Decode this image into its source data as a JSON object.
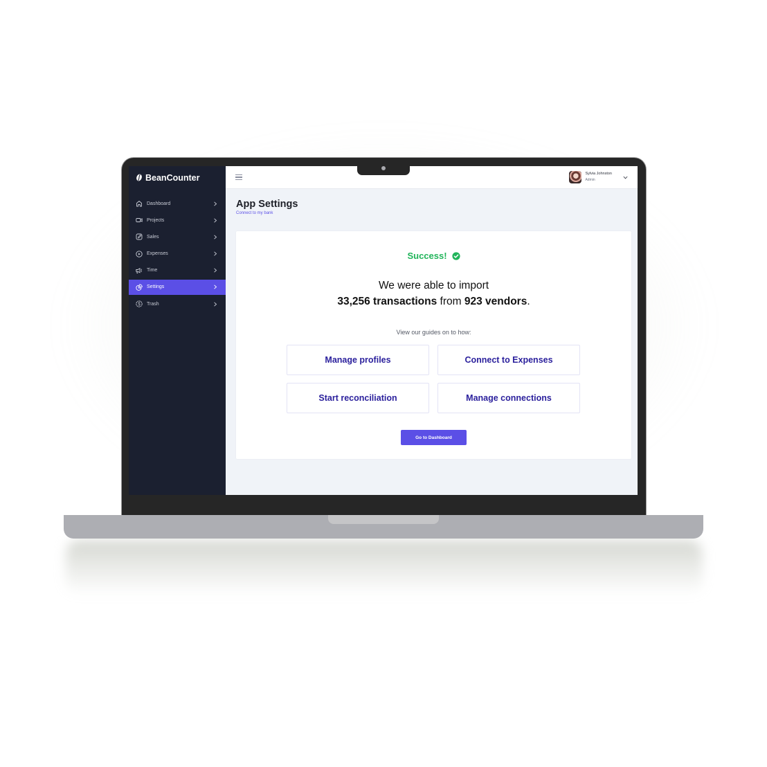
{
  "app": {
    "brand_name": "BeanCounter",
    "accent_color": "#5b4fe6",
    "sidebar_color": "#1b2030",
    "success_color": "#21b45a"
  },
  "sidebar": {
    "items": [
      {
        "label": "Dashboard",
        "icon": "home-icon",
        "active": false
      },
      {
        "label": "Projects",
        "icon": "video-camera-icon",
        "active": false
      },
      {
        "label": "Sales",
        "icon": "edit-square-icon",
        "active": false
      },
      {
        "label": "Expenses",
        "icon": "play-circle-icon",
        "active": false
      },
      {
        "label": "Time",
        "icon": "megaphone-icon",
        "active": false
      },
      {
        "label": "Settings",
        "icon": "pie-chart-icon",
        "active": true
      },
      {
        "label": "Trash",
        "icon": "dollar-circle-icon",
        "active": false
      }
    ]
  },
  "topbar": {
    "menu_icon": "hamburger-icon",
    "user": {
      "name": "Sylvia Johnston",
      "role": "Admin",
      "dropdown_icon": "chevron-down-icon"
    }
  },
  "page": {
    "title": "App Settings",
    "subtitle": "Connect to my bank"
  },
  "result": {
    "status": "Success!",
    "status_icon": "check-circle-icon",
    "line1": "We were able to import",
    "transactions": "33,256 transactions",
    "from_text": " from ",
    "vendors": "923 vendors",
    "period": ".",
    "guides_label": "View our guides on to how:",
    "guides": [
      {
        "label": "Manage profiles"
      },
      {
        "label": "Connect to Expenses"
      },
      {
        "label": "Start reconciliation"
      },
      {
        "label": "Manage connections"
      }
    ],
    "cta_label": "Go to Dashboard"
  }
}
